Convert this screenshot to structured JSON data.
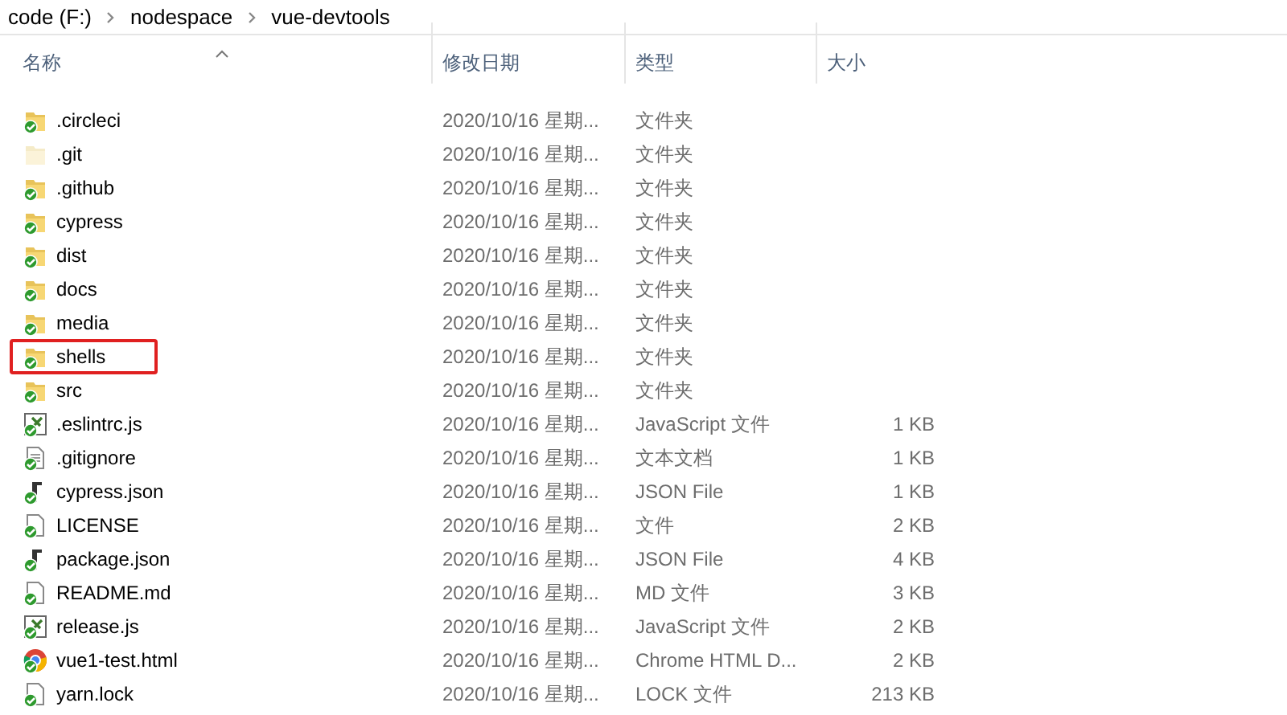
{
  "breadcrumb": [
    "code (F:)",
    "nodespace",
    "vue-devtools"
  ],
  "columns": [
    "名称",
    "修改日期",
    "类型",
    "大小"
  ],
  "rows": [
    {
      "name": ".circleci",
      "date": "2020/10/16 星期...",
      "type": "文件夹",
      "kind": "folder",
      "synced": true,
      "highlighted": false
    },
    {
      "name": ".git",
      "date": "2020/10/16 星期...",
      "type": "文件夹",
      "kind": "hidden-folder",
      "synced": false,
      "highlighted": false
    },
    {
      "name": ".github",
      "date": "2020/10/16 星期...",
      "type": "文件夹",
      "kind": "folder",
      "synced": true,
      "highlighted": false
    },
    {
      "name": "cypress",
      "date": "2020/10/16 星期...",
      "type": "文件夹",
      "kind": "folder",
      "synced": true,
      "highlighted": false
    },
    {
      "name": "dist",
      "date": "2020/10/16 星期...",
      "type": "文件夹",
      "kind": "folder",
      "synced": true,
      "highlighted": false
    },
    {
      "name": "docs",
      "date": "2020/10/16 星期...",
      "type": "文件夹",
      "kind": "folder",
      "synced": true,
      "highlighted": false
    },
    {
      "name": "media",
      "date": "2020/10/16 星期...",
      "type": "文件夹",
      "kind": "folder",
      "synced": true,
      "highlighted": false
    },
    {
      "name": "shells",
      "date": "2020/10/16 星期...",
      "type": "文件夹",
      "kind": "folder",
      "synced": true,
      "highlighted": true
    },
    {
      "name": "src",
      "date": "2020/10/16 星期...",
      "type": "文件夹",
      "kind": "folder",
      "synced": true,
      "highlighted": false
    },
    {
      "name": ".eslintrc.js",
      "date": "2020/10/16 星期...",
      "type": "JavaScript 文件",
      "size": "1 KB",
      "kind": "script",
      "synced": true,
      "highlighted": false
    },
    {
      "name": ".gitignore",
      "date": "2020/10/16 星期...",
      "type": "文本文档",
      "size": "1 KB",
      "kind": "text",
      "synced": true,
      "highlighted": false
    },
    {
      "name": "cypress.json",
      "date": "2020/10/16 星期...",
      "type": "JSON File",
      "size": "1 KB",
      "kind": "json",
      "synced": true,
      "highlighted": false
    },
    {
      "name": "LICENSE",
      "date": "2020/10/16 星期...",
      "type": "文件",
      "size": "2 KB",
      "kind": "file",
      "synced": true,
      "highlighted": false
    },
    {
      "name": "package.json",
      "date": "2020/10/16 星期...",
      "type": "JSON File",
      "size": "4 KB",
      "kind": "json",
      "synced": true,
      "highlighted": false
    },
    {
      "name": "README.md",
      "date": "2020/10/16 星期...",
      "type": "MD 文件",
      "size": "3 KB",
      "kind": "file",
      "synced": true,
      "highlighted": false
    },
    {
      "name": "release.js",
      "date": "2020/10/16 星期...",
      "type": "JavaScript 文件",
      "size": "2 KB",
      "kind": "script",
      "synced": true,
      "highlighted": false
    },
    {
      "name": "vue1-test.html",
      "date": "2020/10/16 星期...",
      "type": "Chrome HTML D...",
      "size": "2 KB",
      "kind": "chrome",
      "synced": true,
      "highlighted": false
    },
    {
      "name": "yarn.lock",
      "date": "2020/10/16 星期...",
      "type": "LOCK 文件",
      "size": "213 KB",
      "kind": "file",
      "synced": true,
      "highlighted": false
    }
  ]
}
